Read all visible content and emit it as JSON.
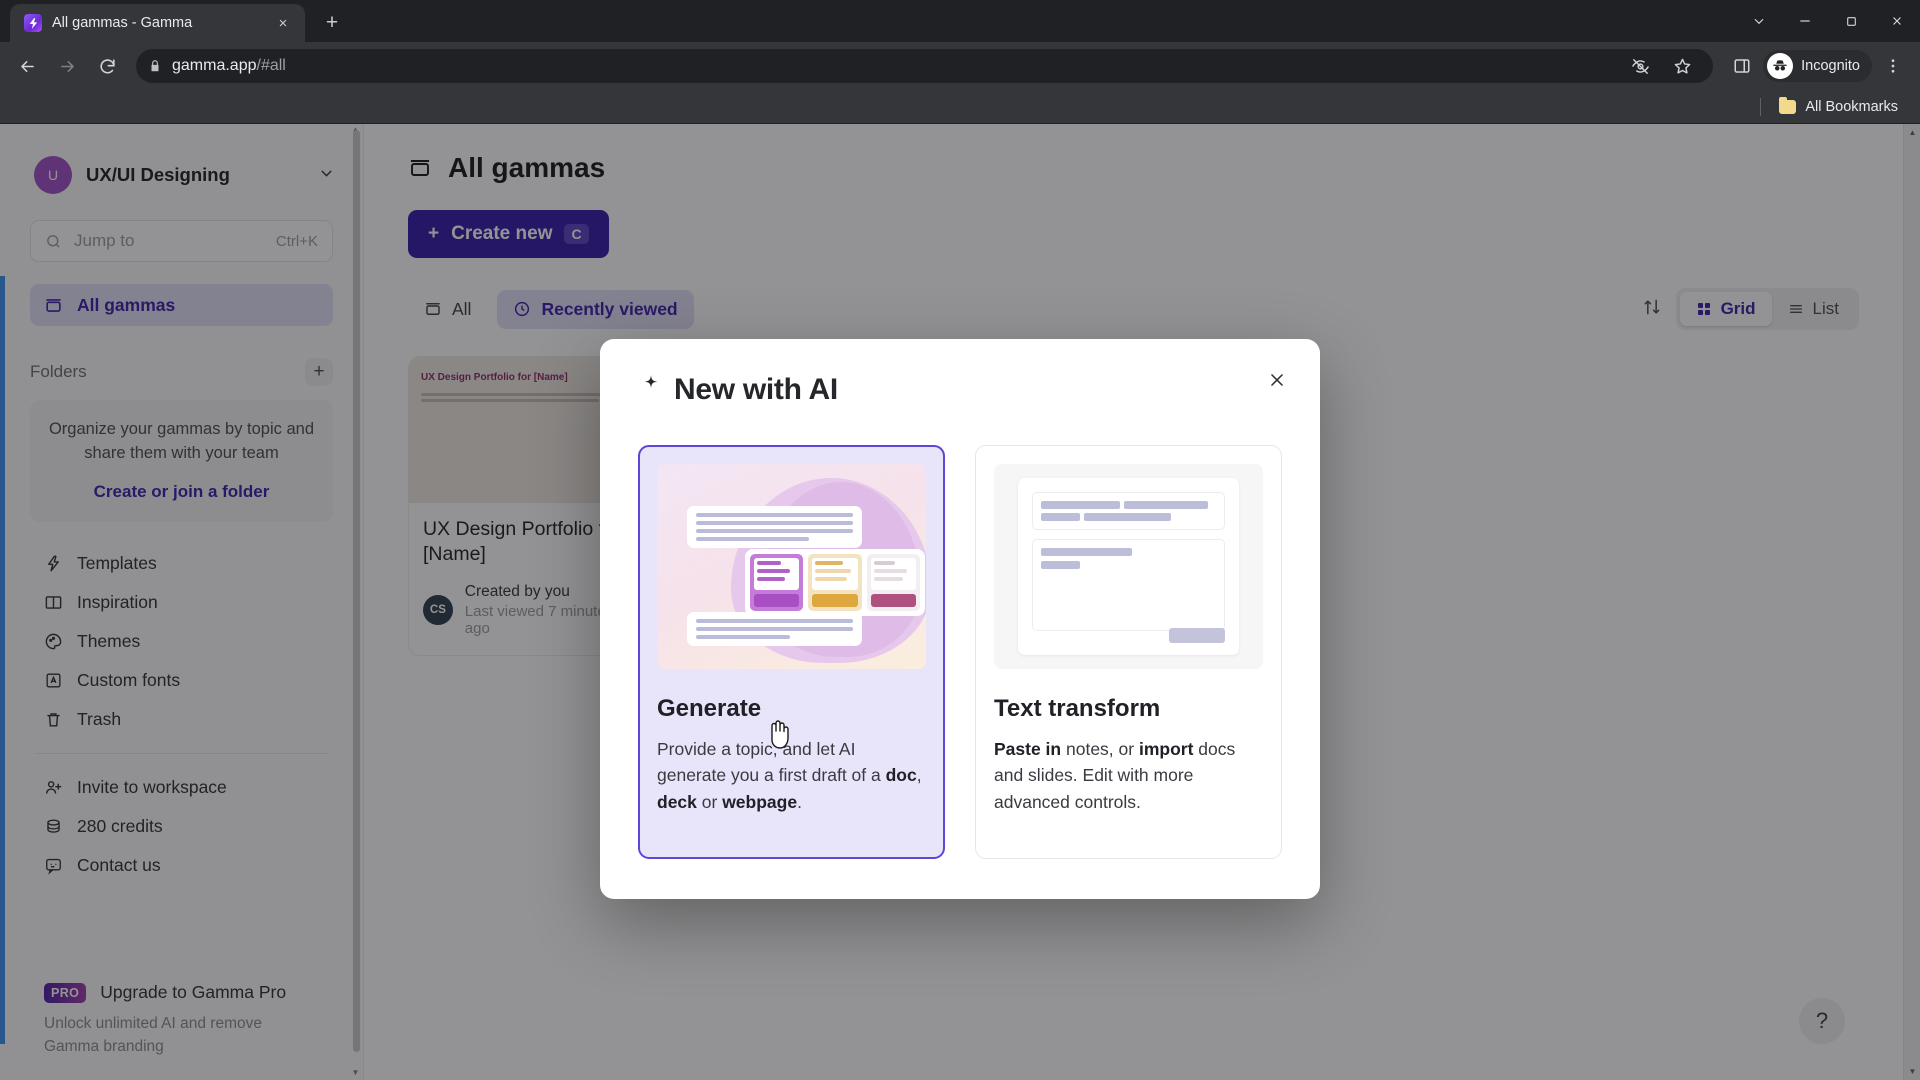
{
  "browser": {
    "tab": {
      "title": "All gammas - Gamma",
      "favicon": "gamma-logo-icon",
      "close_label": "×"
    },
    "new_tab_label": "+",
    "url": "gamma.app",
    "url_path": "/#all",
    "profile_label": "Incognito",
    "bookmarks": {
      "folder_label": "All Bookmarks"
    },
    "window": {
      "minimize": "–",
      "maximize": "❐",
      "close": "✕",
      "tablist": "⌄"
    }
  },
  "sidebar": {
    "workspace": {
      "initial": "U",
      "name": "UX/UI Designing",
      "caret": "⌄"
    },
    "search": {
      "placeholder": "Jump to",
      "shortcut": "Ctrl+K",
      "icon": "search-icon"
    },
    "nav_primary": {
      "label": "All gammas",
      "icon": "archive-icon"
    },
    "folders": {
      "header": "Folders",
      "add_label": "+",
      "empty_text": "Organize your gammas by topic and share them with your team",
      "cta": "Create or join a folder"
    },
    "items": [
      {
        "label": "Templates",
        "icon": "lightning-icon"
      },
      {
        "label": "Inspiration",
        "icon": "book-open-icon"
      },
      {
        "label": "Themes",
        "icon": "palette-icon"
      },
      {
        "label": "Custom fonts",
        "icon": "font-icon"
      },
      {
        "label": "Trash",
        "icon": "trash-icon"
      }
    ],
    "items_secondary": [
      {
        "label": "Invite to workspace",
        "icon": "user-plus-icon"
      },
      {
        "label": "280 credits",
        "icon": "coins-icon"
      },
      {
        "label": "Contact us",
        "icon": "chat-smile-icon"
      }
    ],
    "pro": {
      "badge": "PRO",
      "title": "Upgrade to Gamma Pro",
      "subtitle": "Unlock unlimited AI and remove Gamma branding"
    }
  },
  "main": {
    "title": "All gammas",
    "title_icon": "archive-icon",
    "create_button": {
      "label": "Create new",
      "plus": "+",
      "kbd": "C"
    },
    "filters": [
      {
        "label": "All",
        "icon": "archive-icon",
        "active": false
      },
      {
        "label": "Recently viewed",
        "icon": "clock-icon",
        "active": true
      }
    ],
    "sort_icon": "sort-icon",
    "view": [
      {
        "label": "Grid",
        "icon": "grid-icon",
        "active": true
      },
      {
        "label": "List",
        "icon": "list-icon",
        "active": false
      }
    ],
    "cards": [
      {
        "thumb_title": "UX Design Portfolio for [Name]",
        "title": "UX Design Portfolio for [Name]",
        "avatar_initials": "CS",
        "created_by": "Created by you",
        "last_viewed": "Last viewed 7 minutes ago"
      }
    ],
    "help_label": "?"
  },
  "modal": {
    "title": "New with AI",
    "title_icon": "sparkle-icon",
    "close_label": "✕",
    "options": [
      {
        "id": "generate",
        "title": "Generate",
        "selected": true,
        "description_parts": [
          {
            "text": "Provide a topic, and let AI generate you a first draft of a ",
            "bold": false
          },
          {
            "text": "doc",
            "bold": true
          },
          {
            "text": ", ",
            "bold": false
          },
          {
            "text": "deck",
            "bold": true
          },
          {
            "text": " or ",
            "bold": false
          },
          {
            "text": "webpage",
            "bold": true
          },
          {
            "text": ".",
            "bold": false
          }
        ]
      },
      {
        "id": "text-transform",
        "title": "Text transform",
        "selected": false,
        "description_parts": [
          {
            "text": "Paste in",
            "bold": true
          },
          {
            "text": " notes, or ",
            "bold": false
          },
          {
            "text": "import",
            "bold": true
          },
          {
            "text": " docs and slides. Edit with more advanced controls.",
            "bold": false
          }
        ]
      }
    ]
  },
  "colors": {
    "brand_purple": "#341aa8",
    "accent_light": "#e2e0f5",
    "selected_border": "#6243d8",
    "selected_bg": "#e8e4fa",
    "chrome_dark": "#202124",
    "chrome_toolbar": "#35363a",
    "sidebar_accent_blue": "#3b8ef0"
  }
}
